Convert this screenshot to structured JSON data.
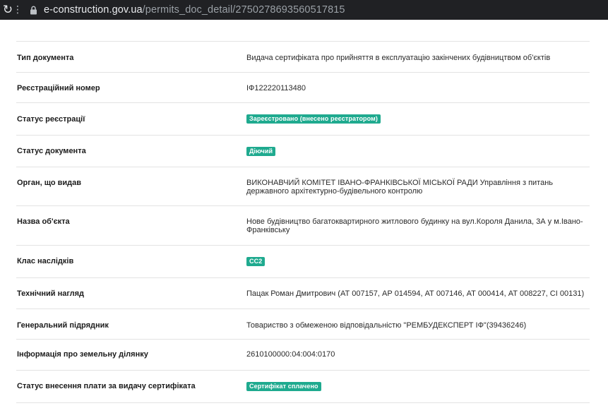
{
  "browser": {
    "url_host": "e-construction.gov.ua",
    "url_path": "/permits_doc_detail/2750278693560517815"
  },
  "rows": [
    {
      "label": "Тип документа",
      "value": "Видача сертифіката про прийняття в експлуатацію закінчених будівництвом об'єктів"
    },
    {
      "label": "Реєстраційний номер",
      "value": "ІФ122220113480"
    },
    {
      "label": "Статус реєстрації",
      "badge": "Зареєстровано (внесено реєстратором)"
    },
    {
      "label": "Статус документа",
      "badge": "Діючий"
    },
    {
      "label": "Орган, що видав",
      "value": "ВИКОНАВЧИЙ КОМІТЕТ ІВАНО-ФРАНКІВСЬКОЇ МІСЬКОЇ РАДИ Управління з питань державного архітектурно-будівельного контролю"
    },
    {
      "label": "Назва об'єкта",
      "value": "Нове будівництво багатоквартирного житлового будинку на вул.Короля Данила, 3А у м.Івано-Франківську"
    },
    {
      "label": "Клас наслідків",
      "badge": "СС2"
    },
    {
      "label": "Технічний нагляд",
      "value": "Пацак Роман Дмитрович (АТ 007157, АР 014594, АТ 007146, АТ 000414, АТ 008227, СІ 00131)"
    },
    {
      "label": "Генеральний підрядник",
      "value": "Товариство з обмеженою відповідальністю \"РЕМБУДЕКСПЕРТ ІФ\"(39436246)"
    },
    {
      "label": "Інформація про земельну ділянку",
      "value": "2610100000:04:004:0170"
    },
    {
      "label": "Статус внесення плати за видачу сертифіката",
      "badge": "Сертифікат сплачено"
    }
  ]
}
